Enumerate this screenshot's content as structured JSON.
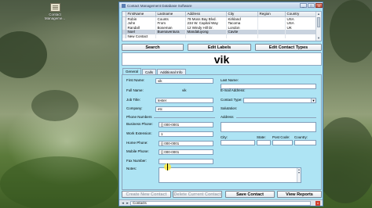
{
  "desktop": {
    "icon_label_line1": "Contact",
    "icon_label_line2": "Manageme..."
  },
  "window": {
    "title": "Contact Management Database Software",
    "controls": {
      "minimize": "_",
      "maximize": "□",
      "close": "x"
    }
  },
  "grid": {
    "columns": [
      "FirstName",
      "Lastname",
      "Address",
      "City",
      "Region",
      "Country"
    ],
    "rows": [
      [
        "Robin",
        "Counts",
        "78 Moss Bay Blvd.",
        "Kirkland",
        "",
        "USA"
      ],
      [
        "John",
        "From",
        "234 W. Capital Way",
        "Tacoma",
        "",
        "USA"
      ],
      [
        "Randall",
        "Boseman",
        "12 Windy Hill Dr.",
        "London",
        "",
        "UK"
      ],
      [
        "Noel",
        "Buenaventura",
        "Mandaluyong",
        "Cavite",
        "",
        ""
      ],
      [
        "New Contact",
        "",
        "",
        "",
        "",
        ""
      ]
    ],
    "selected_row": 3
  },
  "toolbar": {
    "search": "Search",
    "edit_labels": "Edit Labels",
    "edit_contact_types": "Edit Contact Types"
  },
  "contact": {
    "display_name": "vik"
  },
  "tabs": [
    "General",
    "Calls",
    "Additional Info"
  ],
  "form": {
    "first_name_label": "First Name:",
    "first_name": "vik",
    "last_name_label": "Last Name:",
    "last_name": "",
    "full_name_label": "Full Name:",
    "full_name": "vik",
    "email_label": "E-mail Address:",
    "email": "",
    "job_title_label": "Job Title:",
    "job_title": "tester",
    "contact_type_label": "Contact Type:",
    "contact_type": "",
    "company_label": "Company:",
    "company": "etc",
    "salutation_label": "Salutation:",
    "salutation": "",
    "phone_section": "Phone Numbers",
    "address_section": "Address",
    "business_phone_label": "Business Phone:",
    "business_phone": "() 000-0001",
    "work_extension_label": "Work Extension:",
    "work_extension": "1",
    "home_phone_label": "Home Phone:",
    "home_phone": "() 000-0001",
    "mobile_phone_label": "Mobile Phone:",
    "mobile_phone": "() 000-0001",
    "fax_number_label": "Fax Number:",
    "fax_number": "",
    "notes_label": "Notes:",
    "notes": "",
    "city_label": "City:",
    "state_label": "State:",
    "post_code_label": "Post Code:",
    "country_label": "Country:"
  },
  "actions": {
    "create_new_contact": "Create New Contact",
    "delete_current_contact": "Delete Current Contact",
    "save_contact": "Save Contact",
    "view_reports": "View Reports"
  },
  "bottom_tab": {
    "label": "Contacts"
  }
}
